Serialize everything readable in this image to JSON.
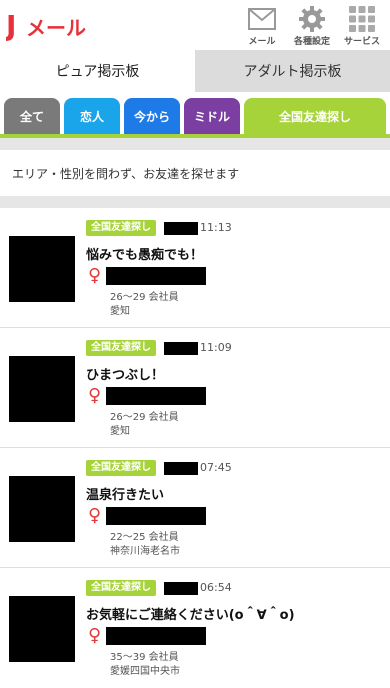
{
  "header": {
    "logo_text": "Jメール",
    "icons": [
      {
        "icon": "mail-icon",
        "label": "メール"
      },
      {
        "icon": "gear-icon",
        "label": "各種設定"
      },
      {
        "icon": "grid-icon",
        "label": "サービス"
      }
    ]
  },
  "board_tabs": [
    {
      "label": "ピュア掲示板",
      "active": true
    },
    {
      "label": "アダルト掲示板",
      "active": false
    }
  ],
  "category_tabs": [
    {
      "label": "全て",
      "color": "#7a7a7a"
    },
    {
      "label": "恋人",
      "color": "#1aa5ea"
    },
    {
      "label": "今から",
      "color": "#1e7ae6"
    },
    {
      "label": "ミドル",
      "color": "#7a3fa0"
    },
    {
      "label": "全国友達探し",
      "color": "#a6d33a"
    }
  ],
  "accent_color": "#a6d33a",
  "description": "エリア・性別を問わず、お友達を探せます",
  "posts": [
    {
      "badge": "全国友達探し",
      "time": "11:13",
      "title": "悩みでも愚痴でも！",
      "gender": "♀",
      "info": "26～29 会社員",
      "area": "愛知"
    },
    {
      "badge": "全国友達探し",
      "time": "11:09",
      "title": "ひまつぶし！",
      "gender": "♀",
      "info": "26～29 会社員",
      "area": "愛知"
    },
    {
      "badge": "全国友達探し",
      "time": "07:45",
      "title": "温泉行きたい",
      "gender": "♀",
      "info": "22～25 会社員",
      "area": "神奈川海老名市"
    },
    {
      "badge": "全国友達探し",
      "time": "06:54",
      "title": "お気軽にご連絡ください(o＾∀＾o)",
      "gender": "♀",
      "info": "35～39 会社員",
      "area": "愛媛四国中央市"
    }
  ]
}
